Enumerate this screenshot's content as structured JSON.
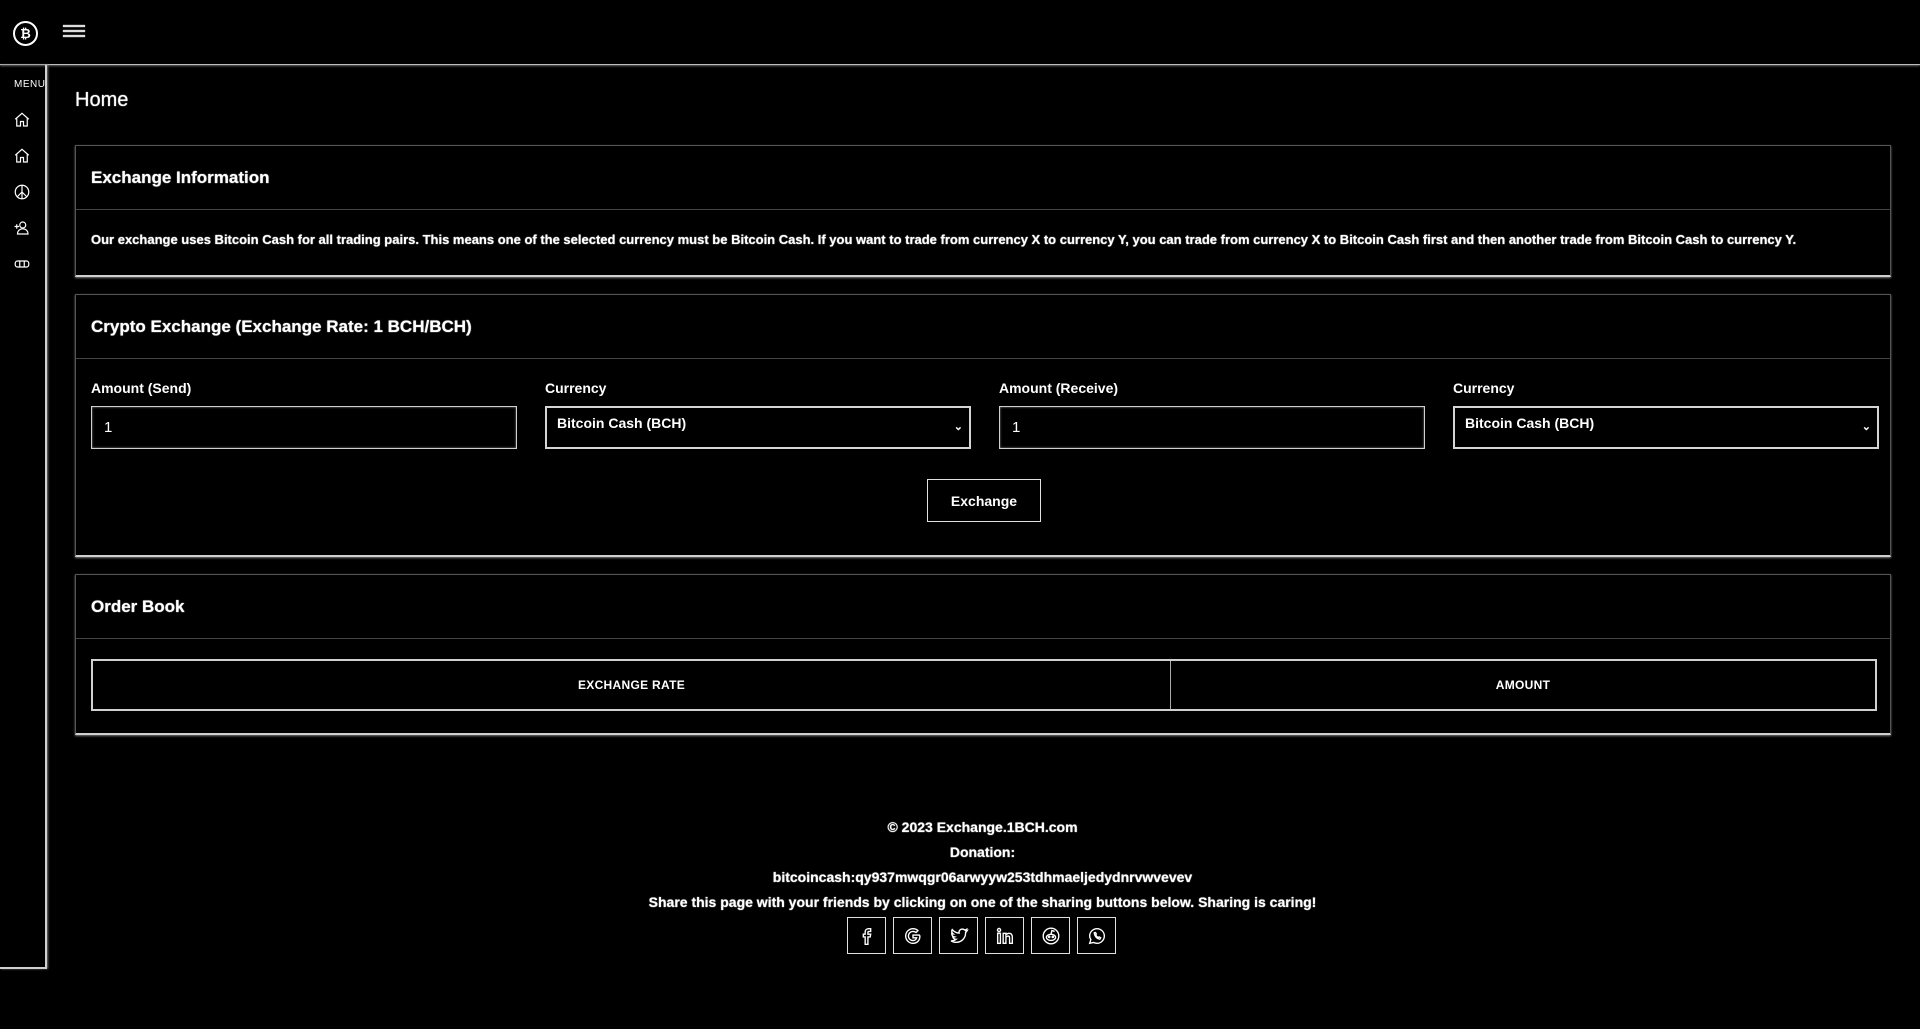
{
  "brand": {
    "logo_glyph": "₿"
  },
  "sidebar": {
    "menu_label": "MENU",
    "items": [
      {
        "icon": "home-icon"
      },
      {
        "icon": "home-icon"
      },
      {
        "icon": "peace-icon"
      },
      {
        "icon": "add-user-icon"
      },
      {
        "icon": "ticket-icon"
      }
    ]
  },
  "page": {
    "title": "Home"
  },
  "info_card": {
    "title": "Exchange Information",
    "text": "Our exchange uses Bitcoin Cash for all trading pairs. This means one of the selected currency must be Bitcoin Cash. If you want to trade from currency X to currency Y, you can trade from currency X to Bitcoin Cash first and then another trade from Bitcoin Cash to currency Y."
  },
  "exchange_card": {
    "title": "Crypto Exchange (Exchange Rate: 1 BCH/BCH)",
    "amount_send_label": "Amount (Send)",
    "amount_send_value": "1",
    "currency_send_label": "Currency",
    "currency_send_value": "Bitcoin Cash (BCH)",
    "amount_receive_label": "Amount (Receive)",
    "amount_receive_value": "1",
    "currency_receive_label": "Currency",
    "currency_receive_value": "Bitcoin Cash (BCH)",
    "exchange_button": "Exchange"
  },
  "order_book": {
    "title": "Order Book",
    "columns": [
      "EXCHANGE RATE",
      "AMOUNT"
    ]
  },
  "footer": {
    "copyright": "© 2023 Exchange.1BCH.com",
    "donation_label": "Donation:",
    "donation_address": "bitcoincash:qy937mwqgr06arwyyw253tdhmaeljedydnrvwvevev",
    "share_text": "Share this page with your friends by clicking on one of the sharing buttons below. Sharing is caring!",
    "share_icons": [
      "facebook-icon",
      "google-icon",
      "twitter-icon",
      "linkedin-icon",
      "reddit-icon",
      "whatsapp-icon"
    ]
  }
}
